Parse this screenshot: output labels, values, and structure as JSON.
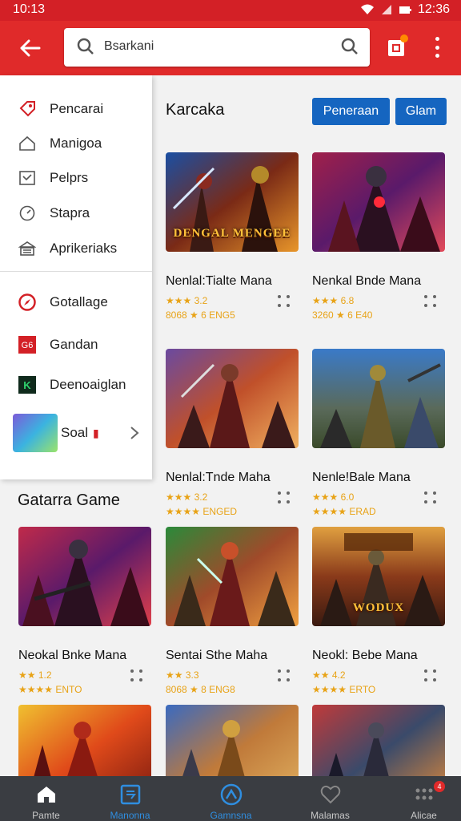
{
  "status_bar": {
    "time": "10:13",
    "clock_right": "12:36"
  },
  "search": {
    "placeholder": "Bsarkani",
    "value": "Bsarkani"
  },
  "menu": {
    "items": [
      {
        "label": "Pencarai",
        "icon": "tag-icon"
      },
      {
        "label": "Manigoa",
        "icon": "home-icon"
      },
      {
        "label": "Pelprs",
        "icon": "inbox-icon"
      },
      {
        "label": "Stapra",
        "icon": "clock-icon"
      },
      {
        "label": "Aprikeriaks",
        "icon": "stack-icon"
      },
      {
        "label": "Gotallage",
        "icon": "compass-icon"
      },
      {
        "label": "Gandan",
        "icon": "g-app-icon"
      },
      {
        "label": "Deenoaiglan",
        "icon": "k-app-icon"
      }
    ],
    "soal": {
      "label": "Soal",
      "marker": "▮"
    }
  },
  "section": {
    "title": "Karcaka",
    "btn_primary": "Peneraan",
    "btn_secondary": "Glam"
  },
  "gallery": {
    "title": "Gatarra Game"
  },
  "cards": [
    {
      "name": "Nenlal:Tialte Mana",
      "rating": "★★★ 3.2",
      "meta": "8068 ★ 6 ENG5",
      "logo": "DENGAL MENGEE"
    },
    {
      "name": "Nenkal Bnde Mana",
      "rating": "★★★ 6.8",
      "meta": "3260 ★ 6 E40",
      "logo": ""
    },
    {
      "name": "Nenlal:Tnde Maha",
      "rating": "★★★ 3.2",
      "meta": "★★★★ ENGED",
      "logo": ""
    },
    {
      "name": "Nenle!Bale Mana",
      "rating": "★★★ 6.0",
      "meta": "★★★★ ERAD",
      "logo": ""
    },
    {
      "name": "Neokal Bnke Mana",
      "rating": "★★ 1.2",
      "meta": "★★★★ ENTO",
      "logo": ""
    },
    {
      "name": "Sentai Sthe Maha",
      "rating": "★★ 3.3",
      "meta": "8068 ★ 8 ENG8",
      "logo": ""
    },
    {
      "name": "Neokl: Bebe Mana",
      "rating": "★★ 4.2",
      "meta": "★★★★ ERTO",
      "logo": "WODUX"
    },
    {
      "name": "",
      "rating": "",
      "meta": "",
      "logo": ""
    },
    {
      "name": "",
      "rating": "",
      "meta": "",
      "logo": ""
    },
    {
      "name": "",
      "rating": "",
      "meta": "",
      "logo": ""
    }
  ],
  "bottom_nav": [
    {
      "label": "Pamte",
      "icon": "home-icon"
    },
    {
      "label": "Manonna",
      "icon": "apps-icon"
    },
    {
      "label": "Gamnsna",
      "icon": "games-icon"
    },
    {
      "label": "Malamas",
      "icon": "chat-icon"
    },
    {
      "label": "Alicae",
      "icon": "more-icon",
      "badge": "4"
    }
  ]
}
